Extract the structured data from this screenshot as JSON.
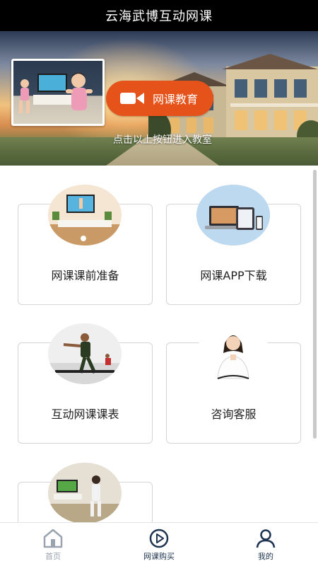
{
  "app": {
    "title": "云海武博互动网课"
  },
  "banner": {
    "cta_label": "网课教育",
    "tip": "点击以上按钮进入教室",
    "cta_color": "#e5531b"
  },
  "grid": {
    "items": [
      {
        "label": "网课课前准备",
        "icon": "tv-room-image"
      },
      {
        "label": "网课APP下载",
        "icon": "devices-image"
      },
      {
        "label": "互动网课课表",
        "icon": "martial-arts-class-image"
      },
      {
        "label": "咨询客服",
        "icon": "customer-service-agent-image"
      },
      {
        "label": "",
        "icon": "home-training-image"
      }
    ]
  },
  "bottom_nav": {
    "items": [
      {
        "label": "首页",
        "icon": "home-icon",
        "color": "#9aa3b0"
      },
      {
        "label": "网课购买",
        "icon": "play-circle-icon",
        "color": "#1e3350"
      },
      {
        "label": "我的",
        "icon": "user-icon",
        "color": "#1e3350"
      }
    ]
  }
}
